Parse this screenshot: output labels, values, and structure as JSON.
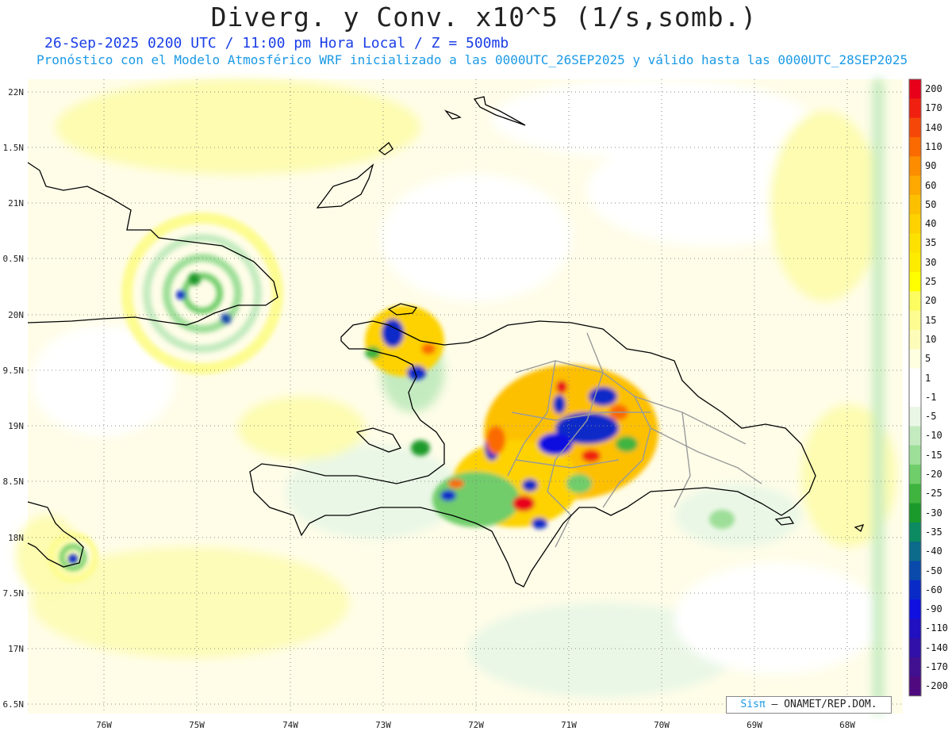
{
  "header": {
    "title": "Diverg. y Conv. x10^5 (1/s,somb.)",
    "subtitle1": "26-Sep-2025 0200 UTC / 11:00 pm Hora Local / Z = 500mb",
    "subtitle2": "Pronóstico con el Modelo Atmosférico WRF inicializado a las 0000UTC_26SEP2025 y válido hasta las  0000UTC_28SEP2025"
  },
  "lat_labels": [
    "22N",
    "1.5N",
    "21N",
    "0.5N",
    "20N",
    "9.5N",
    "19N",
    "8.5N",
    "18N",
    "7.5N",
    "17N",
    "6.5N"
  ],
  "lon_labels": [
    "76W",
    "75W",
    "74W",
    "73W",
    "72W",
    "71W",
    "70W",
    "69W",
    "68W"
  ],
  "colorbar": {
    "labels": [
      "200",
      "170",
      "140",
      "110",
      "90",
      "60",
      "50",
      "40",
      "35",
      "30",
      "25",
      "20",
      "15",
      "10",
      "5",
      "1",
      "-1",
      "-5",
      "-10",
      "-15",
      "-20",
      "-25",
      "-30",
      "-35",
      "-40",
      "-50",
      "-60",
      "-90",
      "-110",
      "-140",
      "-170",
      "-200"
    ],
    "colors": [
      "#e8001a",
      "#f02010",
      "#f54808",
      "#fa6a00",
      "#fc8c00",
      "#fda800",
      "#fdc000",
      "#fdd200",
      "#fde100",
      "#fdeb00",
      "#ffff00",
      "#fdfc60",
      "#fdfc90",
      "#fdfcb8",
      "#fefee0",
      "#ffffff",
      "#ffffff",
      "#eaf7e6",
      "#c4ebc0",
      "#9dde98",
      "#6fcd6a",
      "#3fb43f",
      "#1a9a2a",
      "#0c8a62",
      "#0c6a8a",
      "#0a4aaa",
      "#0a2ac8",
      "#1010e0",
      "#2010c0",
      "#3010a8",
      "#401090",
      "#500a80"
    ]
  },
  "credit": {
    "sis": "Sisπ",
    "text": "– ONAMET/REP.DOM."
  }
}
